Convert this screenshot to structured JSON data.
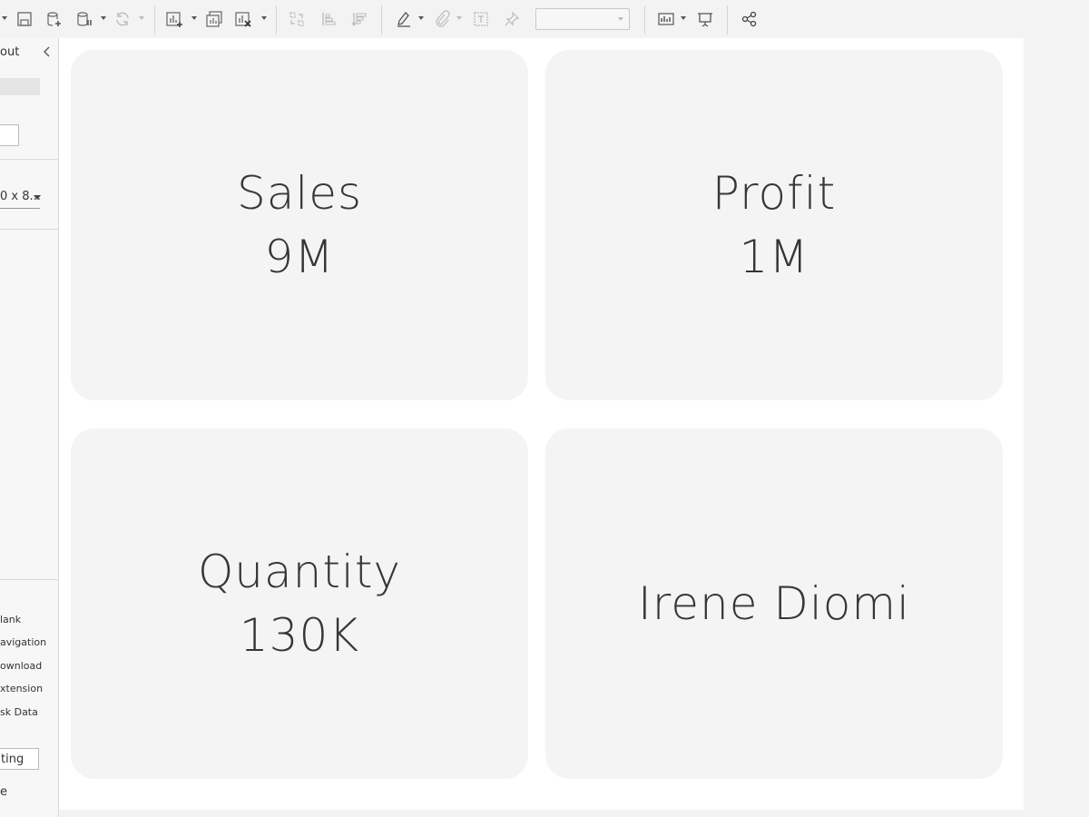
{
  "side_panel": {
    "title": "out",
    "collapse_icon": "chevron-left-icon",
    "size_label": "0 x 8...",
    "objects": [
      {
        "label": "lank"
      },
      {
        "label": "avigation"
      },
      {
        "label": "ownload"
      },
      {
        "label": "xtension"
      },
      {
        "label": "sk Data"
      }
    ],
    "button_label": "ting",
    "last_label": "e"
  },
  "toolbar": {
    "icons": [
      "save-icon",
      "new-data-source-icon",
      "pause-auto-updates-icon",
      "refresh-icon",
      "new-worksheet-icon",
      "duplicate-sheet-icon",
      "clear-sheet-icon",
      "swap-icon",
      "sort-ascending-icon",
      "sort-descending-icon",
      "highlight-icon",
      "group-icon",
      "label-icon",
      "pin-icon",
      "show-me-icon",
      "presentation-icon",
      "share-icon"
    ],
    "fit_select_value": ""
  },
  "tiles": [
    {
      "label": "Sales",
      "value": "9M"
    },
    {
      "label": "Profit",
      "value": "1M"
    },
    {
      "label": "Quantity",
      "value": "130K"
    },
    {
      "label": "Irene Diomi",
      "value": ""
    }
  ]
}
